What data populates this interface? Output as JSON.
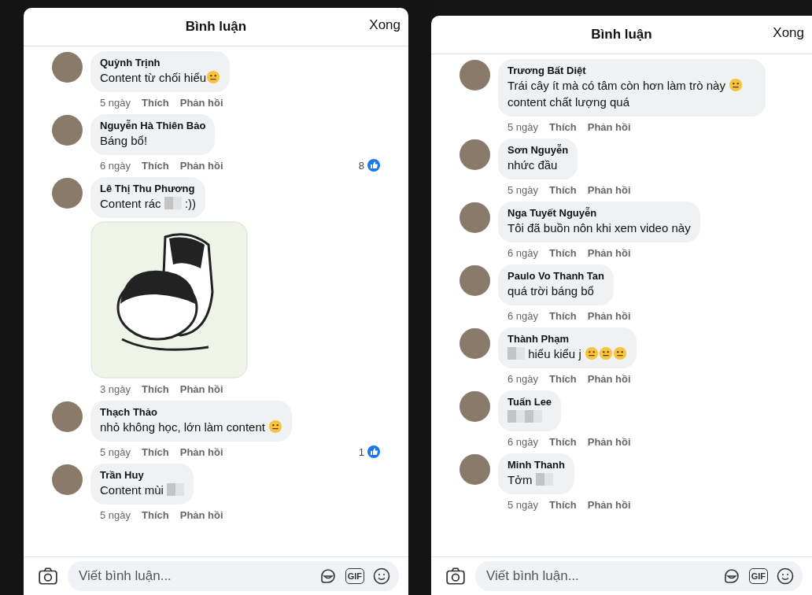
{
  "panels": [
    {
      "title": "Bình luận",
      "done": "Xong",
      "comments": [
        {
          "name": "Quỳnh Trịnh",
          "parts": [
            {
              "kind": "text",
              "text": "Content từ chối hiểu"
            },
            {
              "kind": "emoji"
            }
          ],
          "time": "5 ngày",
          "like": "Thích",
          "reply": "Phản hồi"
        },
        {
          "name": "Nguyễn Hà Thiên Bảo",
          "parts": [
            {
              "kind": "text",
              "text": "Báng bổ!"
            }
          ],
          "time": "6 ngày",
          "like": "Thích",
          "reply": "Phản hồi",
          "likes": "8"
        },
        {
          "name": "Lê Thị Thu Phương",
          "parts": [
            {
              "kind": "text",
              "text": "Content rác "
            },
            {
              "kind": "censored"
            },
            {
              "kind": "text",
              "text": " :))"
            }
          ],
          "sticker": true,
          "time": "3 ngày",
          "like": "Thích",
          "reply": "Phản hồi"
        },
        {
          "name": "Thạch Thảo",
          "parts": [
            {
              "kind": "text",
              "text": "nhỏ không học, lớn làm content "
            },
            {
              "kind": "emoji"
            }
          ],
          "time": "5 ngày",
          "like": "Thích",
          "reply": "Phản hồi",
          "likes": "1"
        },
        {
          "name": "Trần Huy",
          "parts": [
            {
              "kind": "text",
              "text": "Content mùi "
            },
            {
              "kind": "censored"
            }
          ],
          "time": "5 ngày",
          "like": "Thích",
          "reply": "Phản hồi"
        }
      ],
      "composer": {
        "placeholder": "Viết bình luận...",
        "gif": "GIF"
      }
    },
    {
      "title": "Bình luận",
      "done": "Xong",
      "comments": [
        {
          "name": "Trương Bất Diệt",
          "parts": [
            {
              "kind": "text",
              "text": "Trái cây ít mà có tâm còn hơn làm trò này "
            },
            {
              "kind": "emoji"
            },
            {
              "kind": "text",
              "text": " content chất lượng quá"
            }
          ],
          "time": "5 ngày",
          "like": "Thích",
          "reply": "Phản hồi"
        },
        {
          "name": "Sơn Nguyễn",
          "parts": [
            {
              "kind": "text",
              "text": "nhức đầu"
            }
          ],
          "time": "5 ngày",
          "like": "Thích",
          "reply": "Phản hồi"
        },
        {
          "name": "Nga Tuyết Nguyễn",
          "parts": [
            {
              "kind": "text",
              "text": "Tôi đã buồn nôn khi xem video này"
            }
          ],
          "time": "6 ngày",
          "like": "Thích",
          "reply": "Phản hồi"
        },
        {
          "name": "Paulo Vo Thanh Tan",
          "parts": [
            {
              "kind": "text",
              "text": "quá trời báng bổ"
            }
          ],
          "time": "6 ngày",
          "like": "Thích",
          "reply": "Phản hồi"
        },
        {
          "name": "Thành Phạm",
          "parts": [
            {
              "kind": "censored"
            },
            {
              "kind": "text",
              "text": " hiểu kiểu j "
            },
            {
              "kind": "emoji"
            },
            {
              "kind": "emoji"
            },
            {
              "kind": "emoji"
            }
          ],
          "time": "6 ngày",
          "like": "Thích",
          "reply": "Phản hồi"
        },
        {
          "name": "Tuấn Lee",
          "parts": [
            {
              "kind": "censored"
            },
            {
              "kind": "censored"
            }
          ],
          "time": "6 ngày",
          "like": "Thích",
          "reply": "Phản hồi"
        },
        {
          "name": "Minh Thanh",
          "parts": [
            {
              "kind": "text",
              "text": "Tởm "
            },
            {
              "kind": "censored"
            }
          ],
          "time": "5 ngày",
          "like": "Thích",
          "reply": "Phản hồi"
        }
      ],
      "composer": {
        "placeholder": "Viết bình luận...",
        "gif": "GIF"
      }
    }
  ]
}
